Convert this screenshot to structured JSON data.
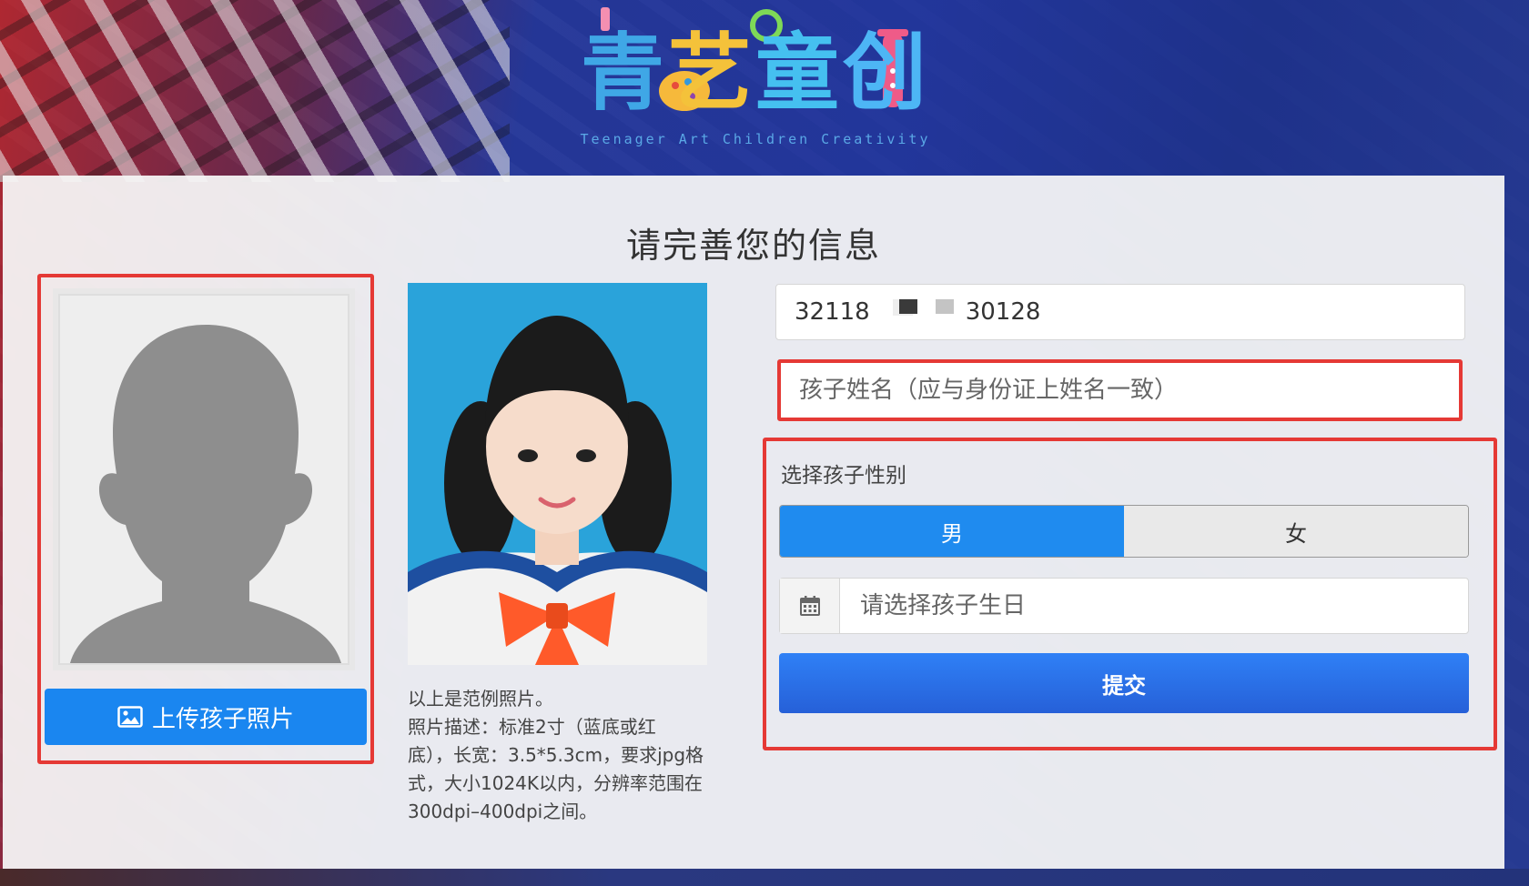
{
  "logo": {
    "title_chars": [
      "青",
      "艺",
      "童",
      "创"
    ],
    "subtitle": "Teenager Art Children Creativity"
  },
  "form": {
    "title": "请完善您的信息",
    "id_number": {
      "prefix": "32118",
      "suffix": "30128"
    },
    "name_placeholder": "孩子姓名（应与身份证上姓名一致）",
    "gender_label": "选择孩子性别",
    "gender_options": [
      "男",
      "女"
    ],
    "gender_selected": "男",
    "birthday_placeholder": "请选择孩子生日",
    "submit_label": "提交"
  },
  "upload": {
    "button_label": "上传孩子照片",
    "icon": "image-icon"
  },
  "sample": {
    "description_lines": [
      "以上是范例照片。",
      "照片描述：标准2寸（蓝底或红",
      "底），长宽：3.5*5.3cm，要求jpg格",
      "式，大小1024K以内，分辨率范围在",
      "300dpi–400dpi之间。"
    ]
  },
  "colors": {
    "primary": "#1f8bef",
    "highlight_border": "#e53935",
    "submit_gradient_top": "#2f80f6",
    "submit_gradient_bottom": "#2660d8"
  }
}
